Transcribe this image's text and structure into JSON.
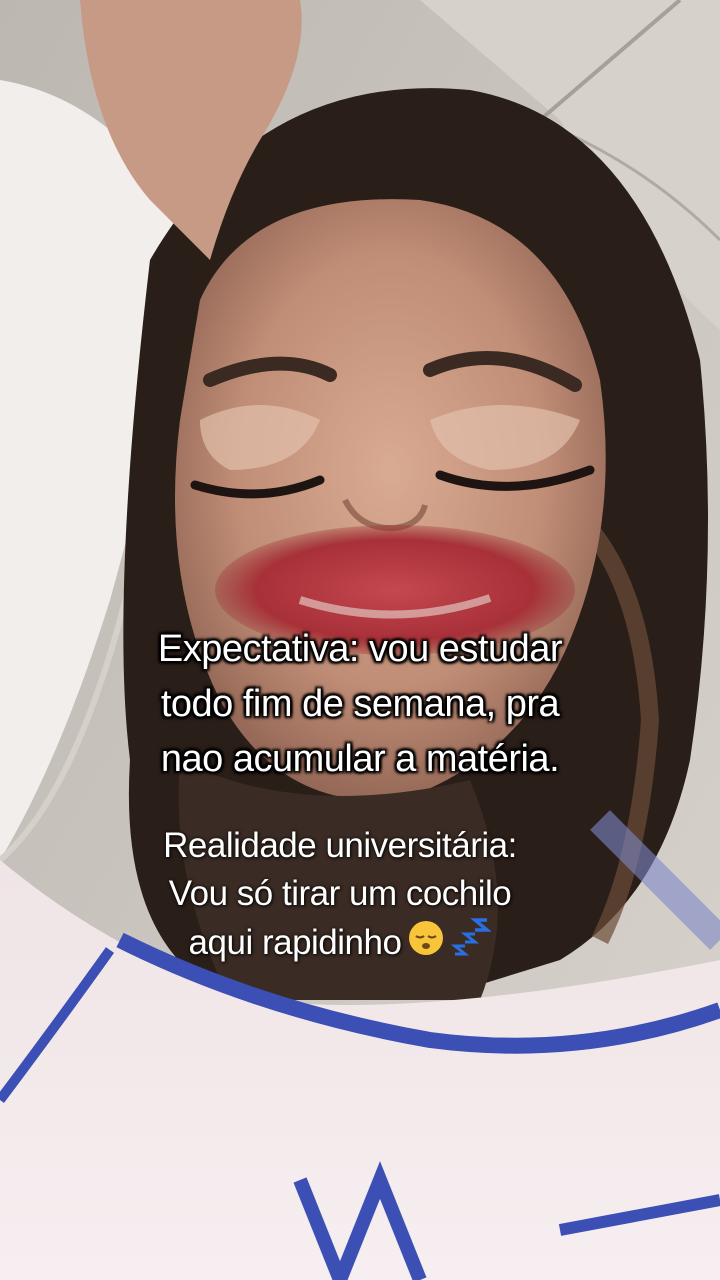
{
  "caption_top": {
    "lines": [
      "Expectativa: vou estudar",
      "todo fim de semana, pra",
      "nao acumular a matéria."
    ]
  },
  "caption_bottom": {
    "lines": [
      "Realidade universitária:",
      "Vou só tirar um cochilo",
      "aqui rapidinho"
    ],
    "emoji_icons": [
      "sleeping-face-icon",
      "zzz-icon"
    ]
  },
  "colors": {
    "text": "#ffffff",
    "pajama_blue": "#3c4fb5",
    "lip_filter": "#b8383f",
    "hair": "#2a1e19"
  }
}
